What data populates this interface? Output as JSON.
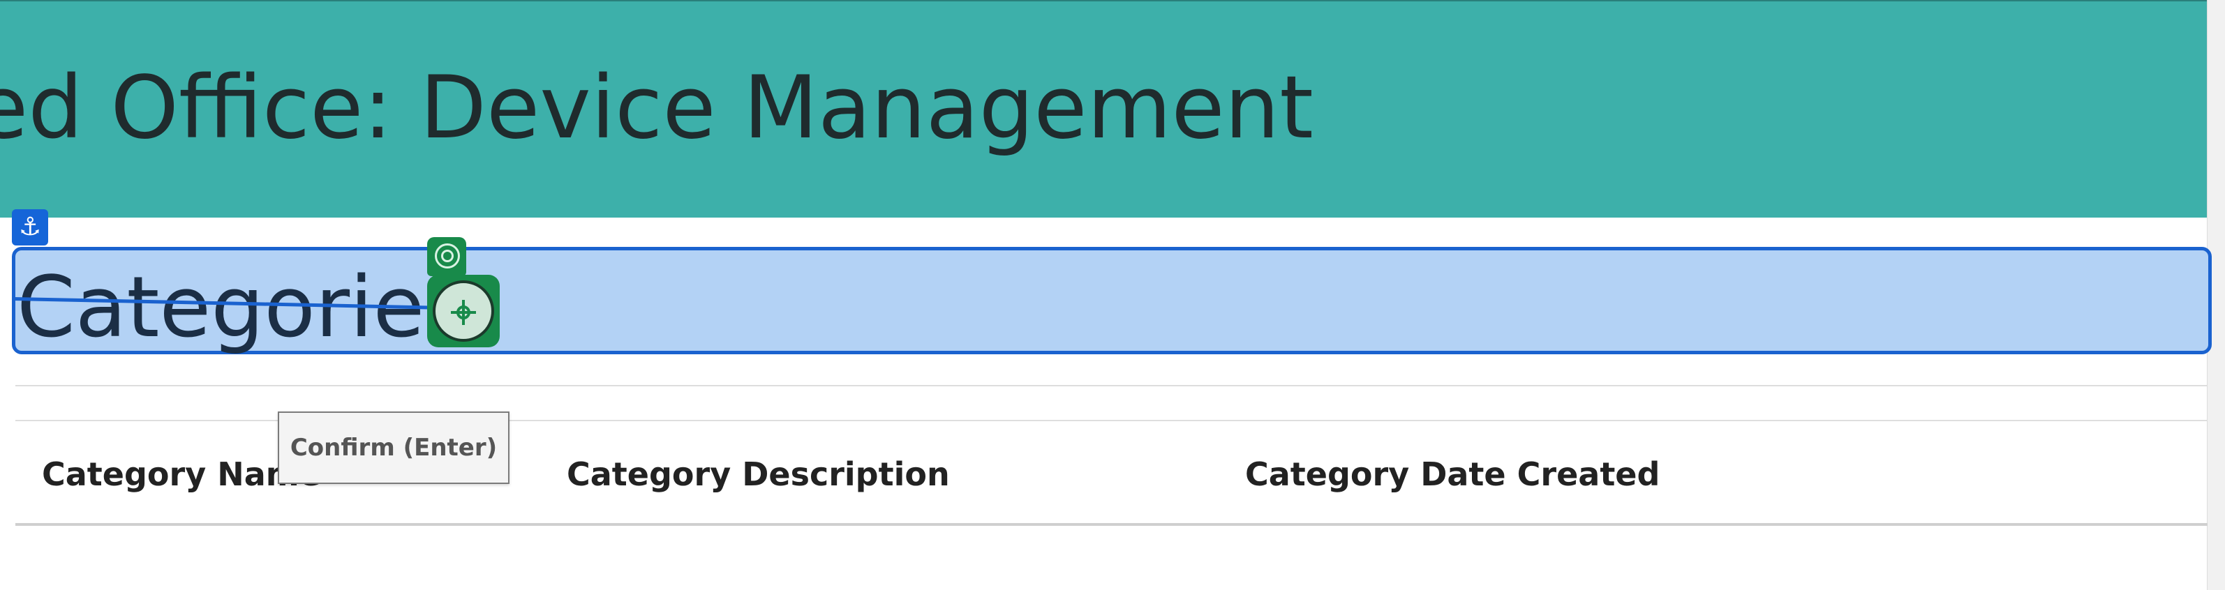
{
  "header": {
    "title": "ed Office: Device Management"
  },
  "section": {
    "title": "Categories"
  },
  "table": {
    "columns": [
      "Category Name",
      "Category Description",
      "Category Date Created"
    ]
  },
  "tooltip": {
    "text": "Confirm (Enter)"
  },
  "icons": {
    "anchor": "⚓",
    "corner": "↗"
  },
  "colors": {
    "header_bg": "#3db0aa",
    "selection_fill": "#b3d2f5",
    "selection_border": "#1a62cf",
    "target_green": "#188a4a"
  }
}
